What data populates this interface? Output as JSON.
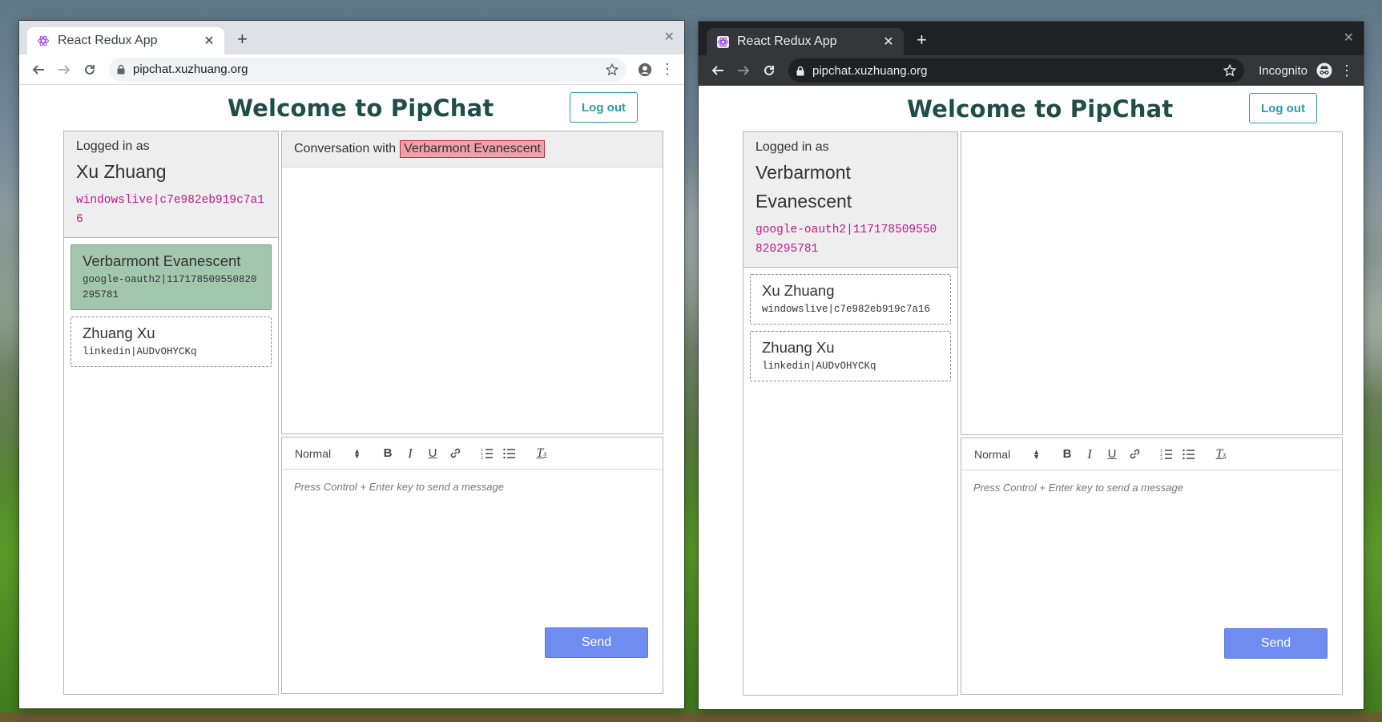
{
  "windows": [
    {
      "theme": "light",
      "tab_title": "React Redux App",
      "url": "pipchat.xuzhuang.org",
      "app_title": "Welcome to PipChat",
      "logout_label": "Log out",
      "me": {
        "caption": "Logged in as",
        "name": "Xu Zhuang",
        "id": "windowslive|c7e982eb919c7a16"
      },
      "contacts": [
        {
          "name": "Verbarmont Evanescent",
          "id": "google-oauth2|117178509550820295781",
          "active": true
        },
        {
          "name": "Zhuang Xu",
          "id": "linkedin|AUDvOHYCKq",
          "active": false
        }
      ],
      "conversation": {
        "prefix": "Conversation with",
        "with_name": "Verbarmont Evanescent"
      },
      "editor": {
        "format": "Normal",
        "placeholder": "Press Control + Enter key to send a message",
        "send_label": "Send"
      }
    },
    {
      "theme": "dark",
      "tab_title": "React Redux App",
      "url": "pipchat.xuzhuang.org",
      "incognito_label": "Incognito",
      "app_title": "Welcome to PipChat",
      "logout_label": "Log out",
      "me": {
        "caption": "Logged in as",
        "name": "Verbarmont Evanescent",
        "id": "google-oauth2|117178509550820295781"
      },
      "contacts": [
        {
          "name": "Xu Zhuang",
          "id": "windowslive|c7e982eb919c7a16",
          "active": false
        },
        {
          "name": "Zhuang Xu",
          "id": "linkedin|AUDvOHYCKq",
          "active": false
        }
      ],
      "editor": {
        "format": "Normal",
        "placeholder": "Press Control + Enter key to send a message",
        "send_label": "Send"
      }
    }
  ],
  "colors": {
    "title": "#1f4d47",
    "accent": "#2a9ca6",
    "user_id": "#c2188a",
    "active_contact": "#a3c7ae",
    "highlight": "#f0a0a8",
    "send_button": "#6f8cf0"
  }
}
